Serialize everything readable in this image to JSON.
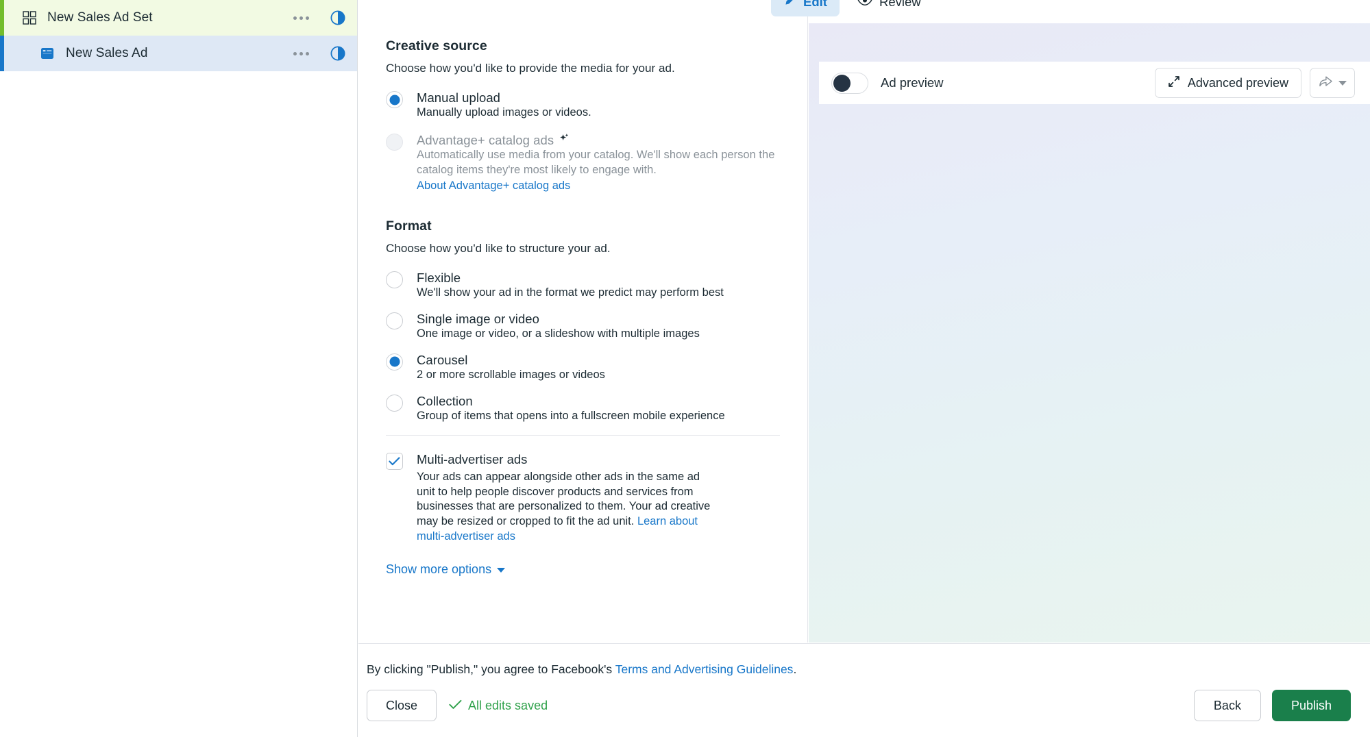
{
  "sidebar": {
    "items": [
      {
        "label": "New Sales Ad Set",
        "icon": "grid-icon",
        "accent_color": "#73bd2c",
        "row_color": "#f2fae3",
        "status": "draft-half-circle"
      },
      {
        "label": "New Sales Ad",
        "icon": "ad-card-icon",
        "accent_color": "#1877c9",
        "row_color": "#dee8f5",
        "status": "draft-half-circle"
      }
    ],
    "more_menu_label": "More options"
  },
  "tabs": [
    {
      "label": "Edit",
      "icon": "pencil-icon",
      "active": true
    },
    {
      "label": "Review",
      "icon": "eye-icon",
      "active": false
    }
  ],
  "creative_source": {
    "title": "Creative source",
    "subtitle": "Choose how you'd like to provide the media for your ad.",
    "options": [
      {
        "label": "Manual upload",
        "description": "Manually upload images or videos.",
        "selected": true,
        "disabled": false
      },
      {
        "label": "Advantage+ catalog ads",
        "badge_icon": "sparkle-icon",
        "description": "Automatically use media from your catalog. We'll show each person the catalog items they're most likely to engage with.",
        "link": "About Advantage+ catalog ads",
        "selected": false,
        "disabled": true
      }
    ]
  },
  "format": {
    "title": "Format",
    "subtitle": "Choose how you'd like to structure your ad.",
    "options": [
      {
        "label": "Flexible",
        "description": "We'll show your ad in the format we predict may perform best",
        "selected": false
      },
      {
        "label": "Single image or video",
        "description": "One image or video, or a slideshow with multiple images",
        "selected": false
      },
      {
        "label": "Carousel",
        "description": "2 or more scrollable images or videos",
        "selected": true
      },
      {
        "label": "Collection",
        "description": "Group of items that opens into a fullscreen mobile experience",
        "selected": false
      }
    ]
  },
  "multi_advertiser": {
    "label": "Multi-advertiser ads",
    "checked": true,
    "description": "Your ads can appear alongside other ads in the same ad unit to help people discover products and services from businesses that are personalized to them. Your ad creative may be resized or cropped to fit the ad unit.",
    "link": "Learn about multi-advertiser ads"
  },
  "show_more_options": "Show more options",
  "preview": {
    "toggle_label": "Ad preview",
    "toggle_on": false,
    "advanced_preview_label": "Advanced preview",
    "advanced_preview_icon": "expand-diagonal-icon",
    "share_icon": "share-arrow-icon",
    "share_caret_icon": "chevron-down-icon"
  },
  "footer": {
    "terms_prefix": "By clicking \"Publish,\" you agree to Facebook's ",
    "terms_link": "Terms and Advertising Guidelines",
    "terms_suffix": ".",
    "close_label": "Close",
    "saved_label": "All edits saved",
    "saved_color": "#31a24c",
    "back_label": "Back",
    "publish_label": "Publish",
    "publish_color": "#1a7f4b"
  }
}
